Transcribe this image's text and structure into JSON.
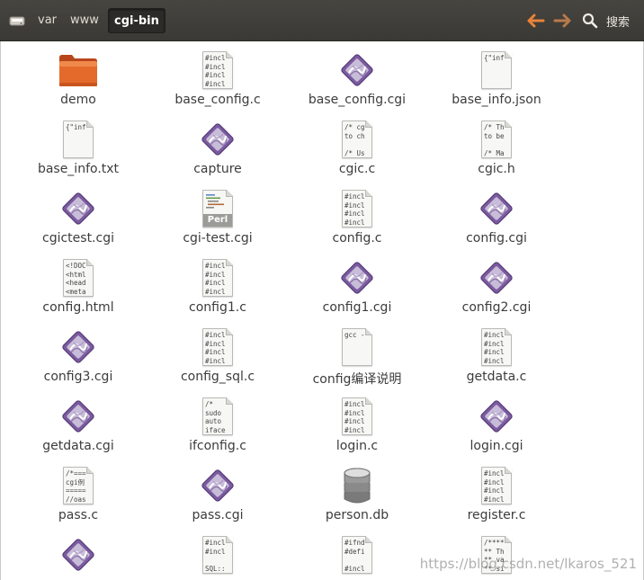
{
  "toolbar": {
    "breadcrumbs": [
      "var",
      "www",
      "cgi-bin"
    ],
    "search_label": "搜索"
  },
  "files": [
    {
      "name": "demo",
      "icon": "folder-icon"
    },
    {
      "name": "base_config.c",
      "icon": "text-file-icon",
      "preview": "#incl\n#incl\n#incl\n#incl"
    },
    {
      "name": "base_config.cgi",
      "icon": "executable-icon"
    },
    {
      "name": "base_info.json",
      "icon": "text-file-icon",
      "preview": "{\"inf"
    },
    {
      "name": "base_info.txt",
      "icon": "text-file-icon",
      "preview": "{\"inf"
    },
    {
      "name": "capture",
      "icon": "executable-icon"
    },
    {
      "name": "cgic.c",
      "icon": "text-file-icon",
      "preview": "/* cg\nto ch\n\n/* Us"
    },
    {
      "name": "cgic.h",
      "icon": "text-file-icon",
      "preview": "/* Th\nto be\n\n/* Ma"
    },
    {
      "name": "cgictest.cgi",
      "icon": "executable-icon"
    },
    {
      "name": "cgi-test.cgi",
      "icon": "perl-script-icon",
      "badge": "Perl"
    },
    {
      "name": "config.c",
      "icon": "text-file-icon",
      "preview": "#incl\n#incl\n#incl\n#incl"
    },
    {
      "name": "config.cgi",
      "icon": "executable-icon"
    },
    {
      "name": "config.html",
      "icon": "text-file-icon",
      "preview": "<!DOC\n<html\n<head\n<meta"
    },
    {
      "name": "config1.c",
      "icon": "text-file-icon",
      "preview": "#incl\n#incl\n#incl\n#incl"
    },
    {
      "name": "config1.cgi",
      "icon": "executable-icon"
    },
    {
      "name": "config2.cgi",
      "icon": "executable-icon"
    },
    {
      "name": "config3.cgi",
      "icon": "executable-icon"
    },
    {
      "name": "config_sql.c",
      "icon": "text-file-icon",
      "preview": "#incl\n#incl\n#incl\n#incl"
    },
    {
      "name": "config编译说明",
      "icon": "text-file-icon",
      "preview": "gcc -"
    },
    {
      "name": "getdata.c",
      "icon": "text-file-icon",
      "preview": "#incl\n#incl\n#incl\n#incl"
    },
    {
      "name": "getdata.cgi",
      "icon": "executable-icon"
    },
    {
      "name": "ifconfig.c",
      "icon": "text-file-icon",
      "preview": "/*\nsudo\nauto\niface"
    },
    {
      "name": "login.c",
      "icon": "text-file-icon",
      "preview": "#incl\n#incl\n#incl\n#incl"
    },
    {
      "name": "login.cgi",
      "icon": "executable-icon"
    },
    {
      "name": "pass.c",
      "icon": "text-file-icon",
      "preview": "/*===\ncgi例\n=====\n//oas"
    },
    {
      "name": "pass.cgi",
      "icon": "executable-icon"
    },
    {
      "name": "person.db",
      "icon": "database-icon"
    },
    {
      "name": "register.c",
      "icon": "text-file-icon",
      "preview": "#incl\n#incl\n#incl\n#incl"
    },
    {
      "name": "",
      "icon": "executable-icon"
    },
    {
      "name": "",
      "icon": "text-file-icon",
      "preview": "#incl\n#incl\n\nSQL::"
    },
    {
      "name": "",
      "icon": "text-file-icon",
      "preview": "#ifnd\n#defi\n\n#incl"
    },
    {
      "name": "",
      "icon": "text-file-icon",
      "preview": "/****\n** Th\n** va\n** si"
    }
  ],
  "watermark": "https://blog.csdn.net/lkaros_521",
  "colors": {
    "toolbar_bg": "#3e3d39",
    "arrow_orange": "#e8833a",
    "folder_orange": "#e46a2c",
    "exec_purple": "#7b5a9f"
  }
}
